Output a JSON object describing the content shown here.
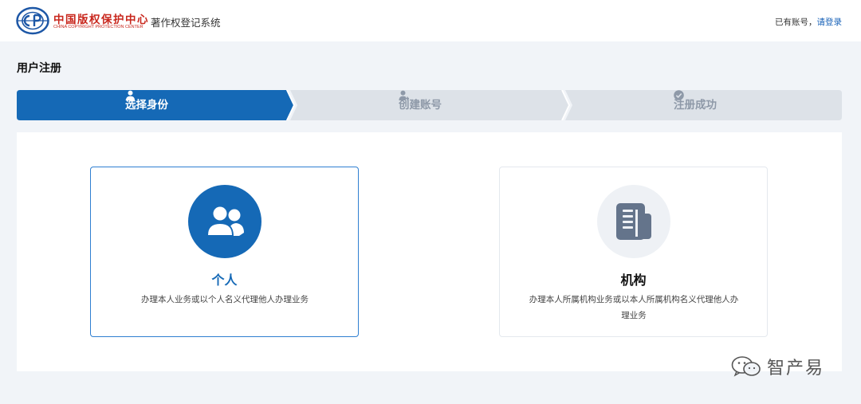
{
  "header": {
    "org_name_cn": "中国版权保护中心",
    "org_name_en": "CHINA COPYRIGHT PROTECTION CENTER",
    "system_name": "著作权登记系统",
    "account_prompt": "已有账号，",
    "login_label": "请登录"
  },
  "page": {
    "title": "用户注册"
  },
  "steps": [
    {
      "label": "选择身份",
      "icon": "user-icon",
      "active": true
    },
    {
      "label": "创建账号",
      "icon": "user-add-icon",
      "active": false
    },
    {
      "label": "注册成功",
      "icon": "check-circle-icon",
      "active": false
    }
  ],
  "cards": {
    "personal": {
      "title": "个人",
      "description": "办理本人业务或以个人名义代理他人办理业务",
      "icon": "users-icon"
    },
    "org": {
      "title": "机构",
      "description": "办理本人所属机构业务或以本人所属机构名义代理他人办理业务",
      "icon": "document-icon"
    }
  },
  "watermark": {
    "text": "智产易",
    "icon": "wechat-icon"
  },
  "colors": {
    "primary": "#1569b6",
    "logo_red": "#c8261c",
    "step_inactive_bg": "#dde2e8",
    "page_bg": "#f1f4f8"
  }
}
